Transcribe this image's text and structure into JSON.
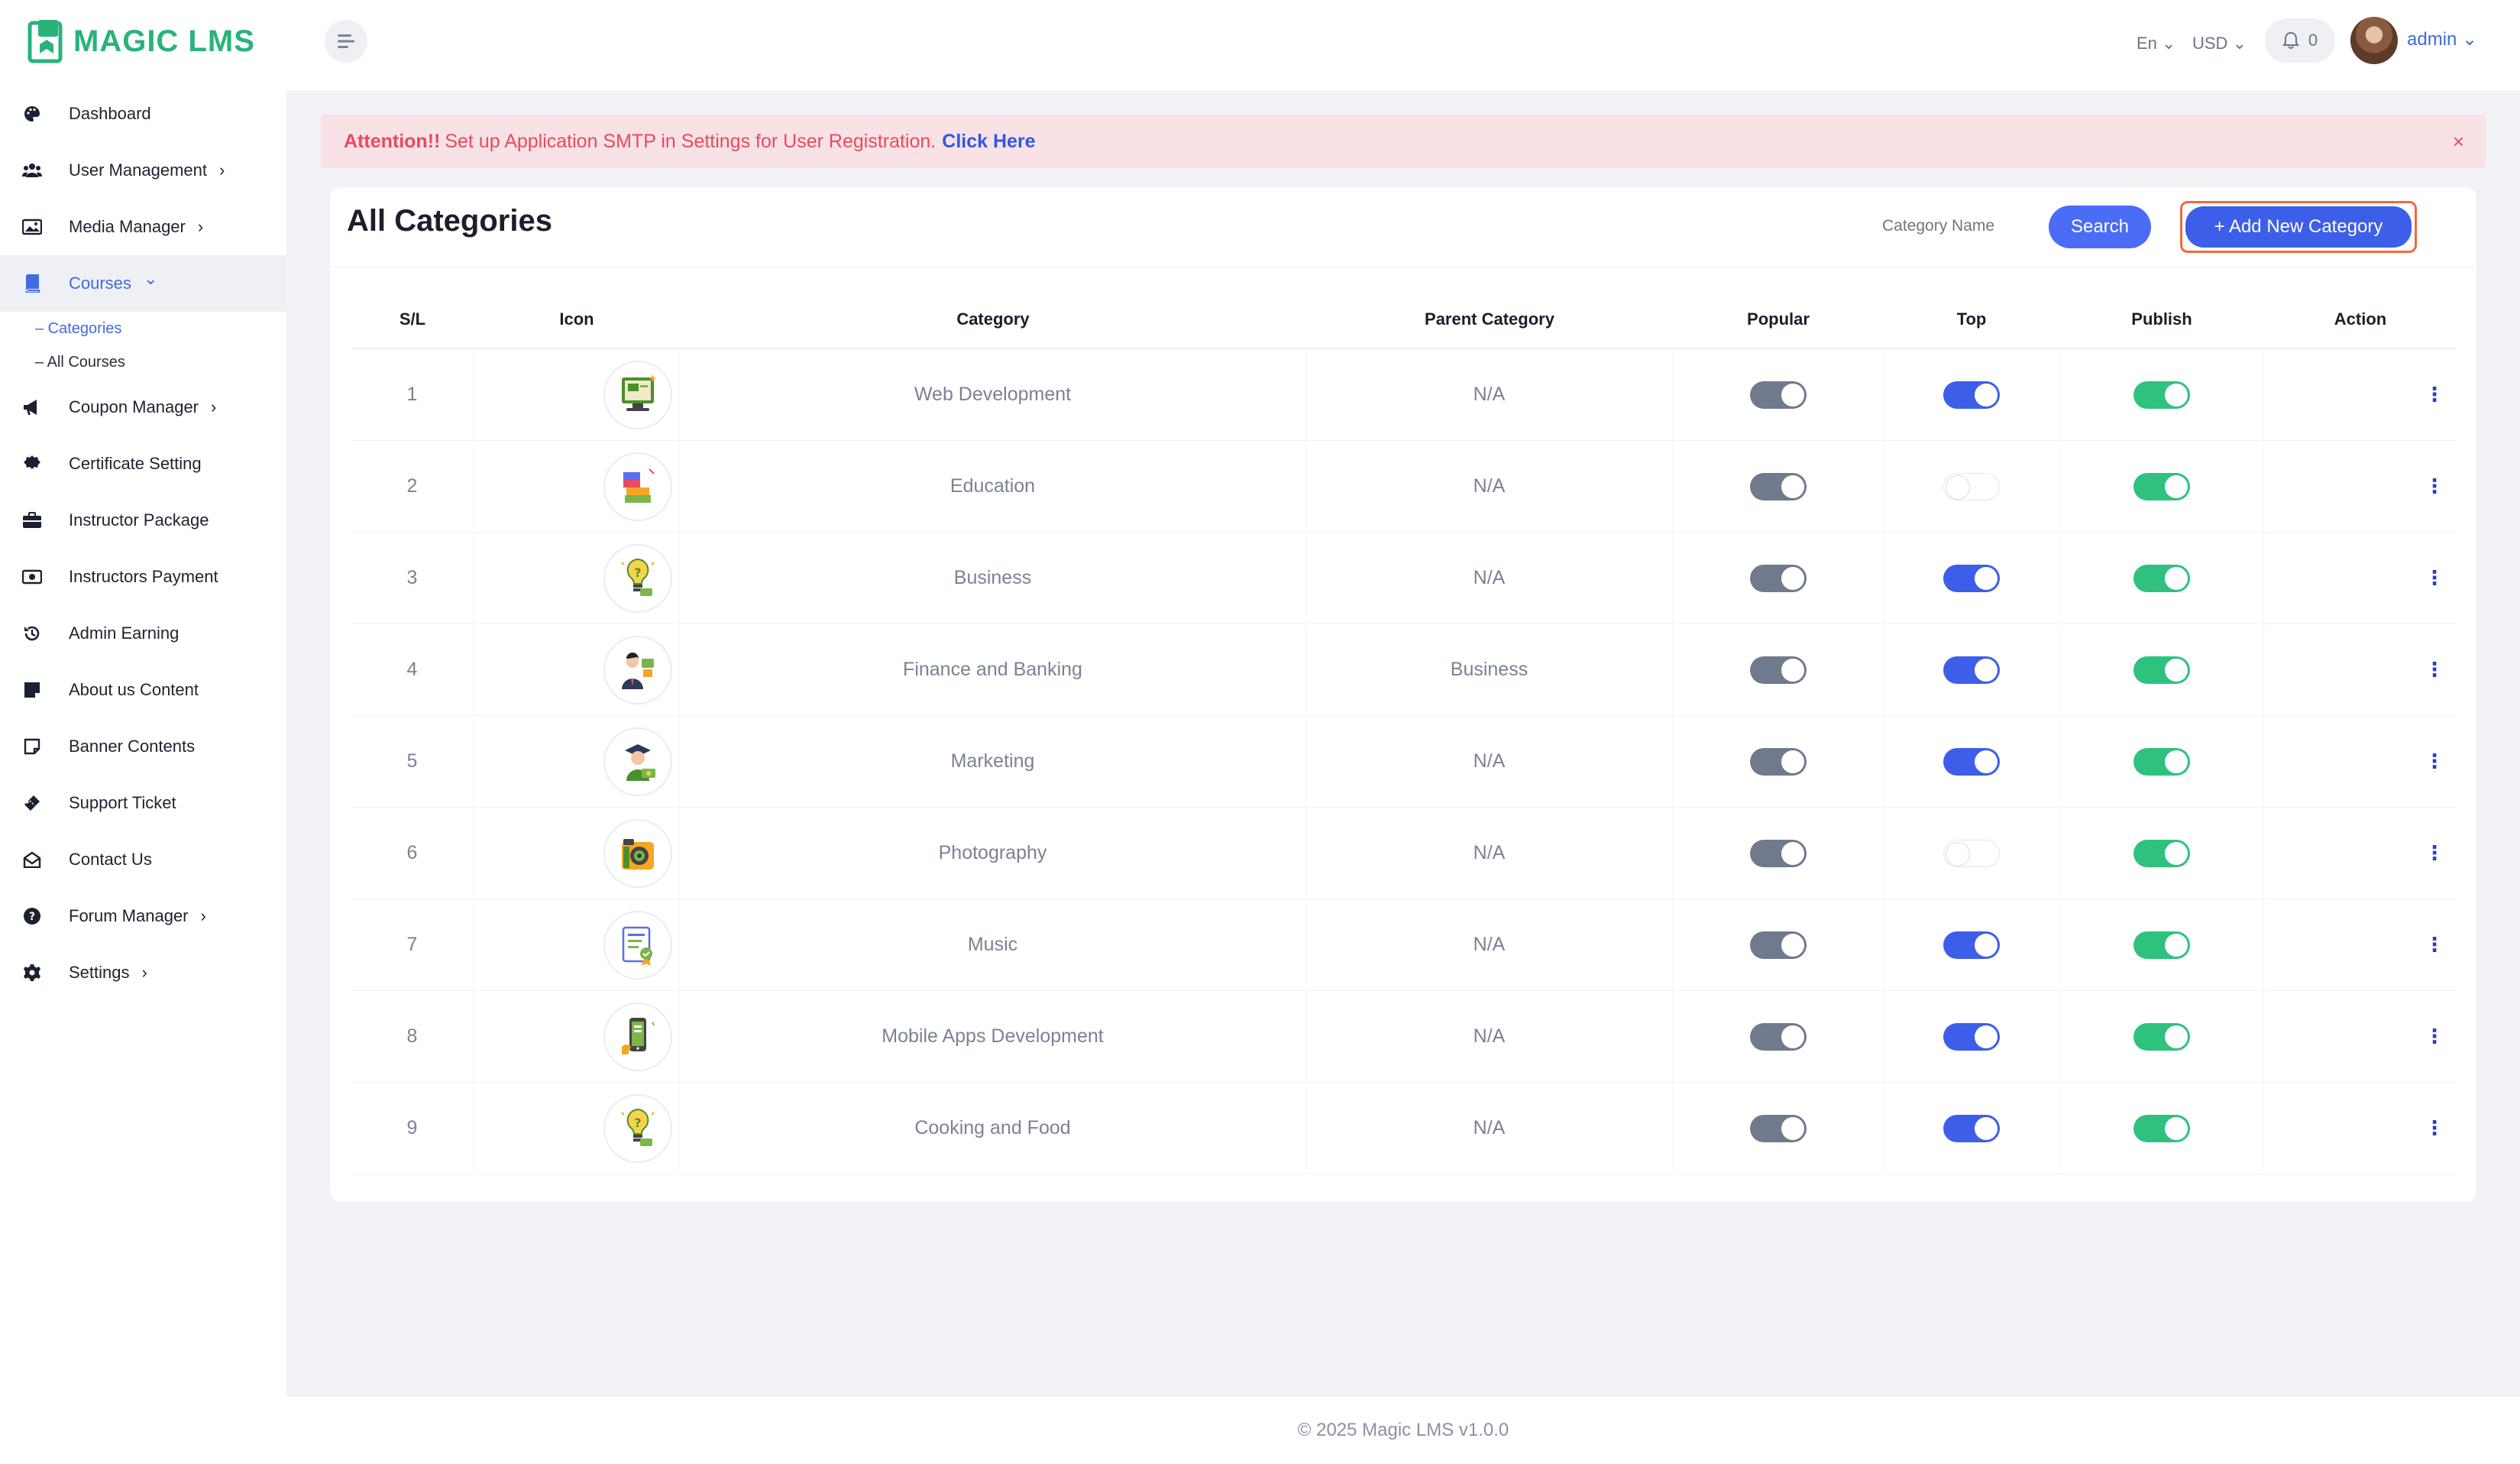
{
  "app": {
    "logo_text": "MAGIC LMS"
  },
  "sidebar": {
    "items": [
      {
        "label": "Dashboard",
        "icon": "palette-icon",
        "chevron": false,
        "active": false
      },
      {
        "label": "User Management",
        "icon": "users-icon",
        "chevron": true,
        "active": false
      },
      {
        "label": "Media Manager",
        "icon": "image-icon",
        "chevron": true,
        "active": false
      },
      {
        "label": "Courses",
        "icon": "book-icon",
        "chevron": true,
        "chevron_down": true,
        "active": true
      },
      {
        "label": "Coupon Manager",
        "icon": "megaphone-icon",
        "chevron": true,
        "active": false
      },
      {
        "label": "Certificate Setting",
        "icon": "certificate-icon",
        "chevron": false,
        "active": false
      },
      {
        "label": "Instructor Package",
        "icon": "briefcase-icon",
        "chevron": false,
        "active": false
      },
      {
        "label": "Instructors Payment",
        "icon": "money-bill-icon",
        "chevron": false,
        "active": false
      },
      {
        "label": "Admin Earning",
        "icon": "history-icon",
        "chevron": false,
        "active": false
      },
      {
        "label": "About us Content",
        "icon": "note-icon",
        "chevron": false,
        "active": false
      },
      {
        "label": "Banner Contents",
        "icon": "sticky-note-icon",
        "chevron": false,
        "active": false
      },
      {
        "label": "Support Ticket",
        "icon": "ticket-icon",
        "chevron": false,
        "active": false
      },
      {
        "label": "Contact Us",
        "icon": "envelope-open-icon",
        "chevron": false,
        "active": false
      },
      {
        "label": "Forum Manager",
        "icon": "question-circle-icon",
        "chevron": true,
        "active": false
      },
      {
        "label": "Settings",
        "icon": "gear-icon",
        "chevron": true,
        "active": false
      }
    ],
    "courses_sub": [
      {
        "label": "– Categories",
        "active": true
      },
      {
        "label": "– All Courses",
        "active": false
      }
    ]
  },
  "topbar": {
    "language": "En",
    "currency": "USD",
    "notification_count": "0",
    "user_name": "admin"
  },
  "alert": {
    "strong": "Attention!!",
    "message": "Set up Application SMTP in Settings for User Registration.",
    "link": "Click Here",
    "close": "×"
  },
  "page": {
    "title": "All Categories",
    "search_placeholder": "Category Name",
    "search_button": "Search",
    "add_button": "+ Add New Category"
  },
  "table": {
    "headers": [
      "S/L",
      "Icon",
      "Category",
      "Parent Category",
      "Popular",
      "Top",
      "Publish",
      "Action"
    ],
    "rows": [
      {
        "sl": "1",
        "icon": "computer-monitor-icon",
        "category": "Web Development",
        "parent": "N/A",
        "popular": true,
        "top": true,
        "publish": true
      },
      {
        "sl": "2",
        "icon": "books-stack-icon",
        "category": "Education",
        "parent": "N/A",
        "popular": true,
        "top": false,
        "publish": true
      },
      {
        "sl": "3",
        "icon": "lightbulb-money-icon",
        "category": "Business",
        "parent": "N/A",
        "popular": true,
        "top": true,
        "publish": true
      },
      {
        "sl": "4",
        "icon": "businessman-icon",
        "category": "Finance and Banking",
        "parent": "Business",
        "popular": true,
        "top": true,
        "publish": true
      },
      {
        "sl": "5",
        "icon": "graduate-money-icon",
        "category": "Marketing",
        "parent": "N/A",
        "popular": true,
        "top": true,
        "publish": true
      },
      {
        "sl": "6",
        "icon": "camera-icon",
        "category": "Photography",
        "parent": "N/A",
        "popular": true,
        "top": false,
        "publish": true
      },
      {
        "sl": "7",
        "icon": "certificate-doc-icon",
        "category": "Music",
        "parent": "N/A",
        "popular": true,
        "top": true,
        "publish": true
      },
      {
        "sl": "8",
        "icon": "mobile-phone-icon",
        "category": "Mobile Apps Development",
        "parent": "N/A",
        "popular": true,
        "top": true,
        "publish": true
      },
      {
        "sl": "9",
        "icon": "lightbulb-money-icon",
        "category": "Cooking and Food",
        "parent": "N/A",
        "popular": true,
        "top": true,
        "publish": true
      }
    ]
  },
  "footer": {
    "text": "© 2025 Magic LMS v1.0.0"
  },
  "colors": {
    "accent": "#4169e1",
    "brand": "#29b37b",
    "toggle_top": "#3d5ee8",
    "toggle_publish": "#2ec27e",
    "toggle_popular": "#6f7a8c",
    "alert_bg": "#f8e2e6",
    "alert_text": "#e84a60"
  }
}
